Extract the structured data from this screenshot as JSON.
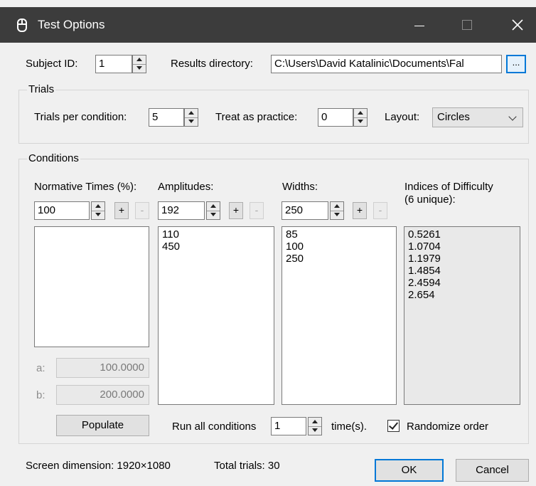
{
  "window": {
    "title": "Test Options",
    "icon": "mouse-icon"
  },
  "top": {
    "subject_id_label": "Subject ID:",
    "subject_id_value": "1",
    "results_dir_label": "Results directory:",
    "results_dir_value": "C:\\Users\\David Katalinic\\Documents\\Fal",
    "browse_label": "..."
  },
  "trials": {
    "title": "Trials",
    "per_condition_label": "Trials per condition:",
    "per_condition_value": "5",
    "practice_label": "Treat as practice:",
    "practice_value": "0",
    "layout_label": "Layout:",
    "layout_value": "Circles"
  },
  "conditions": {
    "title": "Conditions",
    "normative": {
      "label": "Normative Times (%):",
      "value": "100",
      "add": "+",
      "remove": "-",
      "items": []
    },
    "amplitudes": {
      "label": "Amplitudes:",
      "value": "192",
      "add": "+",
      "remove": "-",
      "items": [
        "110",
        "450"
      ]
    },
    "widths": {
      "label": "Widths:",
      "value": "250",
      "add": "+",
      "remove": "-",
      "items": [
        "85",
        "100",
        "250"
      ]
    },
    "difficulty": {
      "label_line1": "Indices of Difficulty",
      "label_line2": "(6 unique):",
      "items": [
        "0.5261",
        "1.0704",
        "1.1979",
        "1.4854",
        "2.4594",
        "2.654"
      ]
    },
    "a_label": "a:",
    "a_value": "100.0000",
    "b_label": "b:",
    "b_value": "200.0000",
    "populate_label": "Populate",
    "run_all_label": "Run all conditions",
    "run_all_value": "1",
    "times_label": "time(s).",
    "randomize_label": "Randomize order",
    "randomize_checked": true
  },
  "footer": {
    "screen_dimension": "Screen dimension: 1920×1080",
    "total_trials": "Total trials: 30",
    "ok_label": "OK",
    "cancel_label": "Cancel"
  },
  "colors": {
    "titlebar": "#3c3c3c",
    "dialog_bg": "#f0f0f0",
    "accent": "#0078d7"
  }
}
